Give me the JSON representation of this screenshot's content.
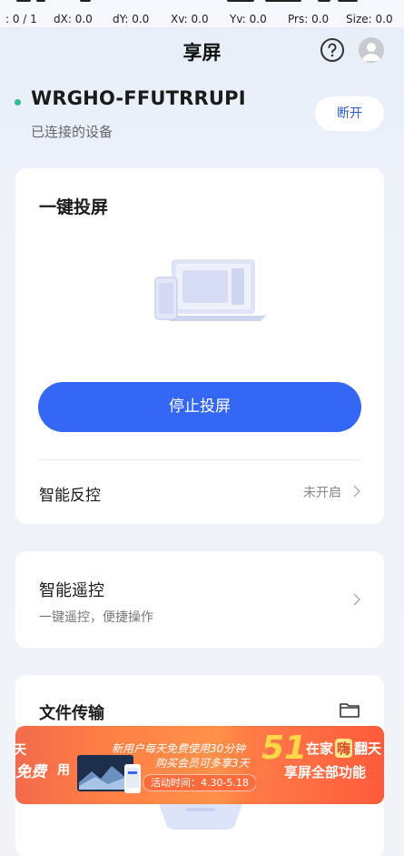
{
  "status_bar": {
    "pointer": ": 0 / 1",
    "dx": "dX: 0.0",
    "dy": "dY: 0.0",
    "xv": "Xv: 0.0",
    "yv": "Yv: 0.0",
    "prs": "Prs: 0.0",
    "size": "Size: 0.0"
  },
  "header": {
    "title": "享屏",
    "help_icon": "question-circle-icon",
    "avatar_icon": "user-avatar-icon"
  },
  "device": {
    "name": "WRGHO-FFUTRRUPI",
    "status": "已连接的设备",
    "status_color": "#2fbf8f",
    "disconnect_label": "断开"
  },
  "cast_card": {
    "title": "一键投屏",
    "stop_label": "停止投屏",
    "accent": "#3467f5",
    "reverse_control_label": "智能反控",
    "reverse_control_value": "未开启"
  },
  "remote_card": {
    "title": "智能遥控",
    "subtitle": "一键遥控，便捷操作"
  },
  "file_card": {
    "title": "文件传输",
    "icon": "folder-icon"
  },
  "banner": {
    "left_top": "天",
    "free": "免费",
    "use": "用",
    "line1": "新用户每天免费使用30分钟",
    "line2": "购买会员可多享3天",
    "pill": "活动时间：4.30-5.18",
    "big": "51",
    "at_home": "在家",
    "hai": "嗨",
    "fan": "翻天",
    "line_right": "享屏全部功能"
  }
}
